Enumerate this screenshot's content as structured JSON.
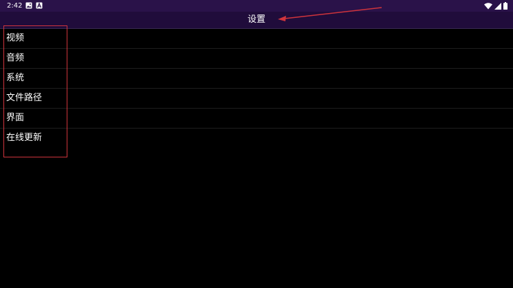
{
  "status_bar": {
    "time": "2:42",
    "left_icons": [
      "image-icon",
      "a-icon"
    ],
    "right_icons": [
      "wifi-icon",
      "signal-icon",
      "battery-icon"
    ]
  },
  "app_bar": {
    "title": "设置"
  },
  "menu": {
    "items": [
      {
        "label": "视频"
      },
      {
        "label": "音频"
      },
      {
        "label": "系统"
      },
      {
        "label": "文件路径"
      },
      {
        "label": "界面"
      },
      {
        "label": "在线更新"
      }
    ]
  },
  "colors": {
    "status_bar_bg": "#2a1249",
    "app_bar_bg": "#200c3b",
    "background": "#000000",
    "annotation_red": "#d0343c",
    "text": "#ffffff"
  }
}
